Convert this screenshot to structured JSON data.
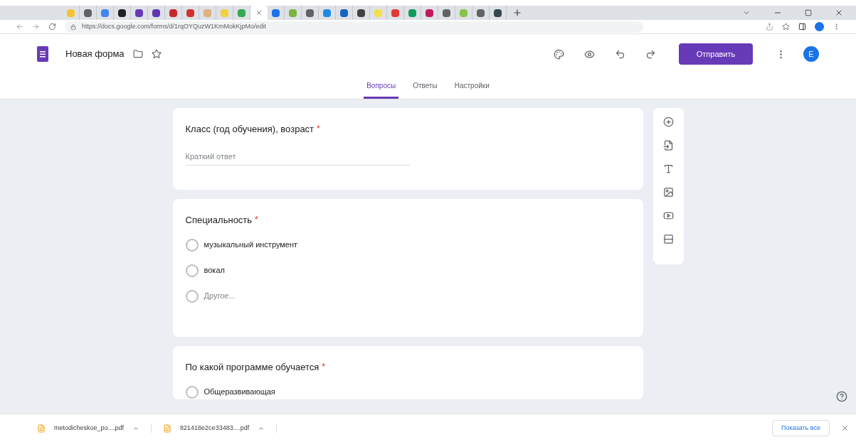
{
  "browser": {
    "tabs": [
      {
        "color": "#f4c430",
        "selected": false
      },
      {
        "color": "#5f6368",
        "selected": false
      },
      {
        "color": "#4285f4",
        "selected": false
      },
      {
        "color": "#202124",
        "selected": false
      },
      {
        "color": "#673ab7",
        "selected": false
      },
      {
        "color": "#5e35b1",
        "selected": false
      },
      {
        "color": "#c62828",
        "selected": false
      },
      {
        "color": "#d32f2f",
        "selected": false
      },
      {
        "color": "#e0b080",
        "selected": false
      },
      {
        "color": "#f4d03f",
        "selected": false
      },
      {
        "color": "#34a853",
        "selected": false
      },
      {
        "selected": true
      },
      {
        "color": "#1a73e8",
        "selected": false
      },
      {
        "color": "#7cb342",
        "selected": false
      },
      {
        "color": "#5f6368",
        "selected": false
      },
      {
        "color": "#1e88e5",
        "selected": false
      },
      {
        "color": "#1565c0",
        "selected": false
      },
      {
        "color": "#424242",
        "selected": false
      },
      {
        "color": "#f4e04d",
        "selected": false
      },
      {
        "color": "#e53935",
        "selected": false
      },
      {
        "color": "#0f9d58",
        "selected": false
      },
      {
        "color": "#c2185b",
        "selected": false
      },
      {
        "color": "#616161",
        "selected": false
      },
      {
        "color": "#8bc34a",
        "selected": false
      },
      {
        "color": "#5f6368",
        "selected": false
      },
      {
        "color": "#37474f",
        "selected": false
      }
    ],
    "url": "https://docs.google.com/forms/d/1rqOYQuzW1KmMokKjpMo/edit"
  },
  "header": {
    "title": "Новая форма",
    "send_button": "Отправить",
    "avatar": "E"
  },
  "tabs": [
    {
      "label": "Вопросы",
      "selected": true
    },
    {
      "label": "Ответы",
      "selected": false
    },
    {
      "label": "Настройки",
      "selected": false
    }
  ],
  "questions": [
    {
      "kind": "short",
      "title": "Класс (год обучения), возраст",
      "required_mark": "*",
      "placeholder": "Краткий ответ"
    },
    {
      "kind": "choice",
      "title": "Специальность",
      "required_mark": "*",
      "options": [
        {
          "label": "музыкальный инструмент",
          "other": false,
          "selected": false
        },
        {
          "label": "вокал",
          "other": false,
          "selected": false
        },
        {
          "label": "Другое...",
          "other": true,
          "selected": false
        }
      ]
    },
    {
      "kind": "choice",
      "title": "По какой программе обучается",
      "required_mark": "*",
      "options": [
        {
          "label": "Общеразвивающая",
          "other": false,
          "selected": false
        }
      ]
    }
  ],
  "downloads": [
    {
      "name": "metodicheskoe_po....pdf"
    },
    {
      "name": "821418e2ce33483....pdf"
    }
  ],
  "show_all": "Показать все"
}
